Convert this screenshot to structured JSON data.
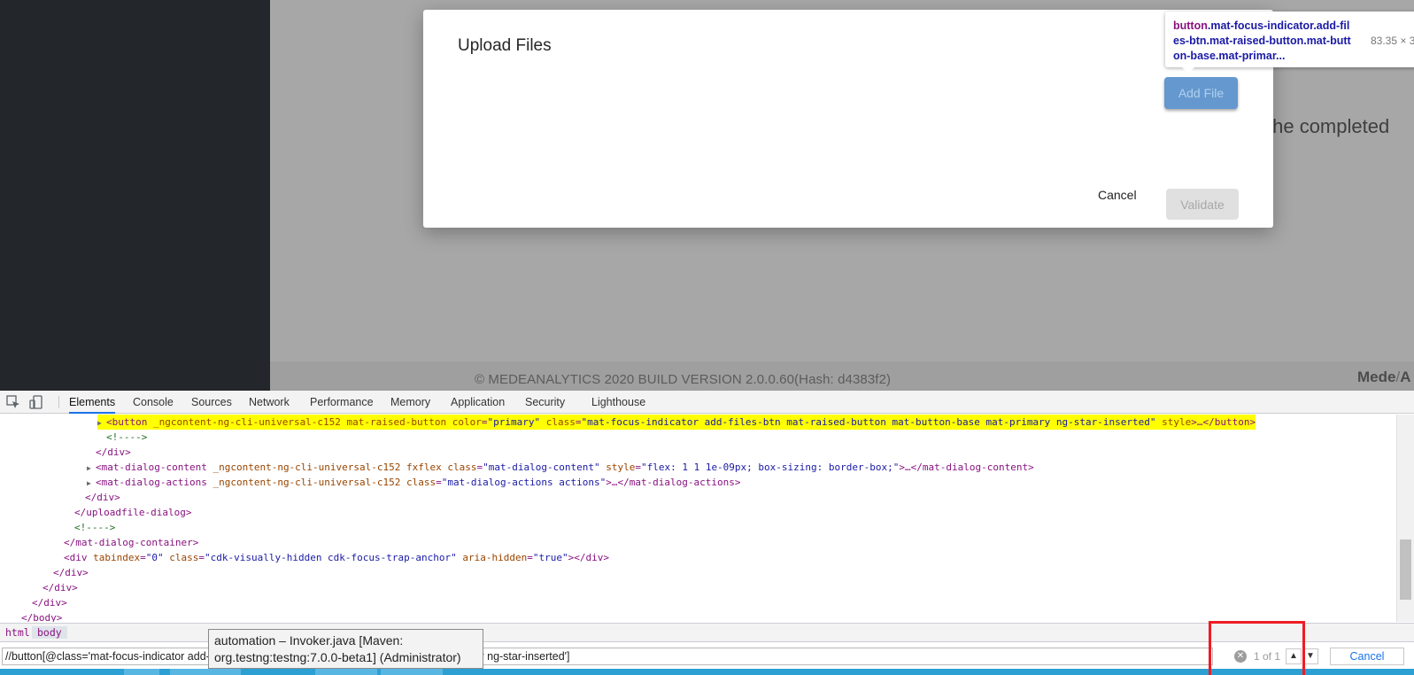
{
  "app": {
    "bg_text": "the completed",
    "footer": "© MEDEANALYTICS 2020 BUILD VERSION 2.0.0.60(Hash: d4383f2)",
    "brand": {
      "left": "Mede",
      "slash": "/",
      "right": "A"
    }
  },
  "dialog": {
    "title": "Upload Files",
    "add_file_label": "Add File",
    "cancel_label": "Cancel",
    "validate_label": "Validate"
  },
  "inspect_tooltip": {
    "tag": "button",
    "selector_line1": ".mat-focus-indicator.add-fil",
    "selector_line2": "es-btn.mat-raised-button.mat-butt",
    "selector_line3": "on-base.mat-primar...",
    "size": "83.35 × 3"
  },
  "devtools": {
    "tabs": [
      "Elements",
      "Console",
      "Sources",
      "Network",
      "Performance",
      "Memory",
      "Application",
      "Security",
      "Lighthouse"
    ],
    "dom": {
      "l0": {
        "tag": "button",
        "a1": "_ngcontent-ng-cli-universal-c152",
        "a2": "mat-raised-button",
        "a3": "color",
        "v3": "\"primary\"",
        "a4": "class",
        "v4": "\"mat-focus-indicator add-files-btn mat-raised-button mat-button-base mat-primary ng-star-inserted\"",
        "a5": "style",
        "tail": ">…</button>"
      },
      "l1": "<!---->",
      "l2": "</div>",
      "l3": {
        "tag": "<mat-dialog-content",
        "a1": "_ngcontent-ng-cli-universal-c152",
        "a2": "fxflex",
        "a3": "class",
        "v3": "\"mat-dialog-content\"",
        "a4": "style",
        "v4": "\"flex: 1 1 1e-09px; box-sizing: border-box;\"",
        "tail": ">…</mat-dialog-content>"
      },
      "l4": {
        "tag": "<mat-dialog-actions",
        "a1": "_ngcontent-ng-cli-universal-c152",
        "a2": "class",
        "v2": "\"mat-dialog-actions actions\"",
        "tail": ">…</mat-dialog-actions>"
      },
      "l5": "</div>",
      "l6": "</uploadfile-dialog>",
      "l7": "<!---->",
      "l8": "</mat-dialog-container>",
      "l9": {
        "tag": "<div",
        "a1": "tabindex",
        "v1": "\"0\"",
        "a2": "class",
        "v2": "\"cdk-visually-hidden cdk-focus-trap-anchor\"",
        "a3": "aria-hidden",
        "v3": "\"true\"",
        "tail": "></div>"
      },
      "l10": "</div>",
      "l11": "</div>",
      "l12": "</div>",
      "l13": "</body>"
    },
    "breadcrumbs": [
      "html",
      "body"
    ],
    "search": {
      "value": "//button[@class='mat-focus-indicator add-files-btn mat-raised-button mat-button-base mat-primary ng-star-inserted']",
      "count": "1 of 1",
      "cancel_label": "Cancel"
    }
  },
  "taskbar_tooltip": {
    "line1": "automation – Invoker.java [Maven:",
    "line2": "org.testng:testng:7.0.0-beta1] (Administrator)"
  },
  "colors": {
    "add_file_button": "#5f8fc8",
    "highlight": "#ffff00",
    "annotation_box": "#ee1c24",
    "taskbar": "#2c9fd3"
  }
}
